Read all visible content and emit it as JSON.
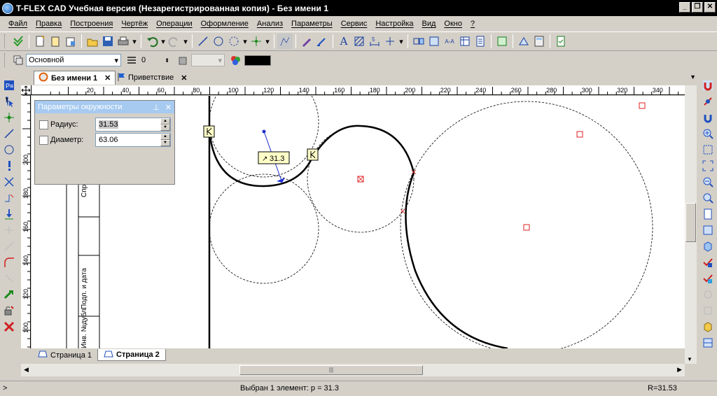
{
  "app": {
    "title": "T-FLEX CAD Учебная версия (Незарегистрированная копия) - Без имени 1"
  },
  "menu": [
    "Файл",
    "Правка",
    "Построения",
    "Чертёж",
    "Операции",
    "Оформление",
    "Анализ",
    "Параметры",
    "Сервис",
    "Настройка",
    "Вид",
    "Окно",
    "?"
  ],
  "toolbar2": {
    "layer_value": "Основной",
    "level_value": "0",
    "color_swatch": "#000000"
  },
  "doc_tabs": [
    {
      "label": "Без имени 1",
      "active": true
    },
    {
      "label": "Приветствие",
      "active": false
    }
  ],
  "ruler": {
    "top_ticks": [
      "20",
      "40",
      "60",
      "80",
      "100",
      "120",
      "140",
      "160",
      "180",
      "200",
      "220",
      "240",
      "260",
      "280",
      "300",
      "320",
      "340"
    ],
    "left_ticks": [
      "200",
      "180",
      "160",
      "140",
      "120",
      "100"
    ]
  },
  "params_panel": {
    "title": "Параметры окружности",
    "radius_label": "Радиус:",
    "radius_value": "31.53",
    "diameter_label": "Диаметр:",
    "diameter_value": "63.06"
  },
  "canvas": {
    "dimension_label": "31.3",
    "title_block_texts": [
      "Спра",
      "Подп. и дата",
      "Инв. №дубл."
    ]
  },
  "page_tabs": [
    {
      "label": "Страница 1",
      "active": false
    },
    {
      "label": "Страница 2",
      "active": true
    }
  ],
  "status": {
    "left": ">",
    "message": "Выбран 1 элемент: p = 31.3",
    "radius": "R=31.53"
  }
}
